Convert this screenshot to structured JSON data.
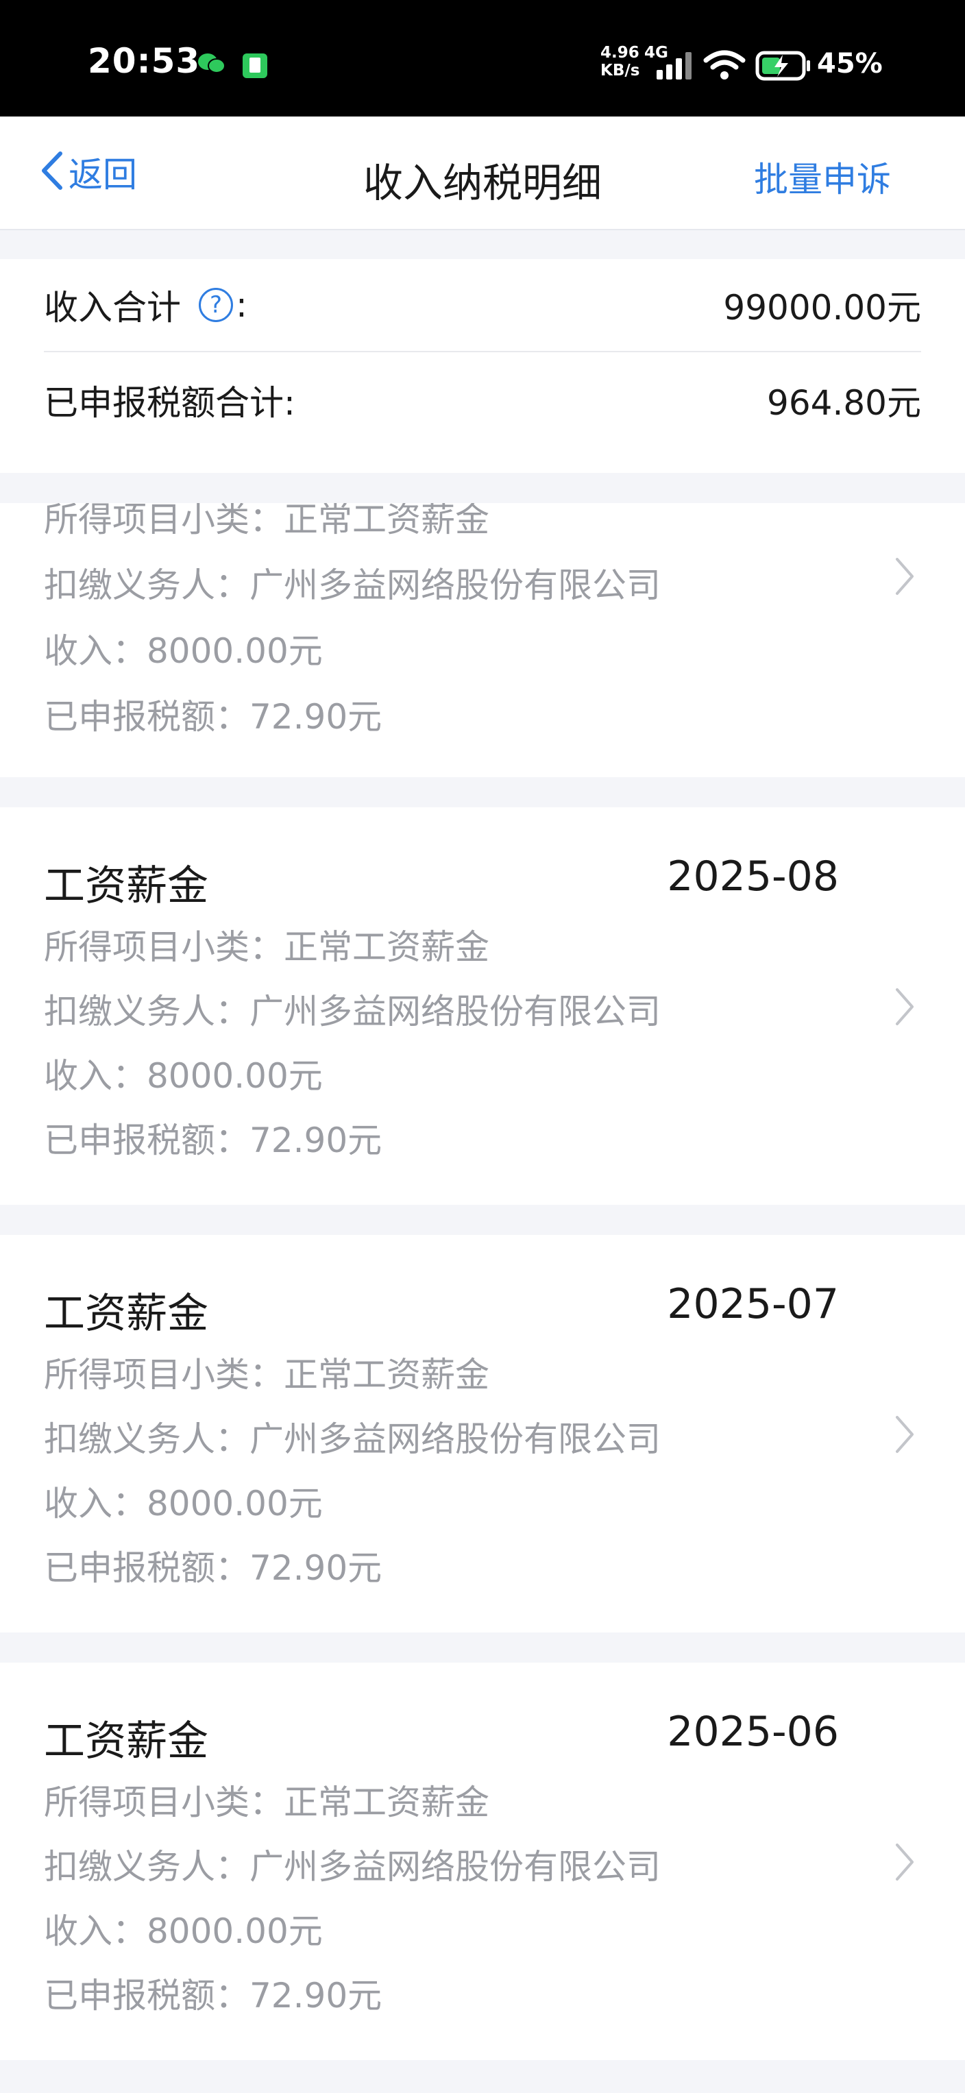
{
  "status_bar": {
    "time": "20:53",
    "net_speed_value": "4.96",
    "net_speed_unit": "KB/s",
    "net_type": "4G",
    "battery": "45%"
  },
  "nav": {
    "back_label": "返回",
    "title": "收入纳税明细",
    "action_label": "批量申诉"
  },
  "summary": {
    "income_label": "收入合计",
    "income_colon": ":",
    "income_value": "99000.00元",
    "tax_label": "已申报税额合计:",
    "tax_value": "964.80元"
  },
  "records": [
    {
      "title": "",
      "date": "",
      "subcategory": "所得项目小类：正常工资薪金",
      "withholder": "扣缴义务人：广州多益网络股份有限公司",
      "income": "收入：8000.00元",
      "tax": "已申报税额：72.90元"
    },
    {
      "title": "工资薪金",
      "date": "2025-08",
      "subcategory": "所得项目小类：正常工资薪金",
      "withholder": "扣缴义务人：广州多益网络股份有限公司",
      "income": "收入：8000.00元",
      "tax": "已申报税额：72.90元"
    },
    {
      "title": "工资薪金",
      "date": "2025-07",
      "subcategory": "所得项目小类：正常工资薪金",
      "withholder": "扣缴义务人：广州多益网络股份有限公司",
      "income": "收入：8000.00元",
      "tax": "已申报税额：72.90元"
    },
    {
      "title": "工资薪金",
      "date": "2025-06",
      "subcategory": "所得项目小类：正常工资薪金",
      "withholder": "扣缴义务人：广州多益网络股份有限公司",
      "income": "收入：8000.00元",
      "tax": "已申报税额：72.90元"
    }
  ],
  "colors": {
    "accent": "#2f7de1",
    "secondary_text": "#9b9da3",
    "page_background": "#f4f5f9"
  }
}
